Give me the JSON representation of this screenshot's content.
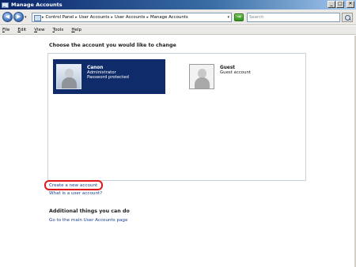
{
  "window": {
    "title": "Manage Accounts",
    "controls": {
      "minimize": "_",
      "maximize": "□",
      "close": "✕"
    }
  },
  "nav": {
    "back_icon": "◀",
    "forward_icon": "▶",
    "dropdown_icon": "▾",
    "address": {
      "breadcrumbs": [
        "Control Panel",
        "User Accounts",
        "User Accounts",
        "Manage Accounts"
      ],
      "separator": "▸"
    },
    "go_label": "→",
    "search_placeholder": "Search"
  },
  "menu": {
    "items": [
      "File",
      "Edit",
      "View",
      "Tools",
      "Help"
    ]
  },
  "main": {
    "heading": "Choose the account you would like to change",
    "accounts": [
      {
        "name": "Canon",
        "lines": [
          "Administrator",
          "Password protected"
        ],
        "selected": true
      },
      {
        "name": "Guest",
        "lines": [
          "Guest account"
        ],
        "selected": false
      }
    ],
    "links": {
      "create": "Create a new account",
      "whatis": "What is a user account?"
    },
    "additional_heading": "Additional things you can do",
    "main_page_link": "Go to the main User Accounts page"
  },
  "colors": {
    "selected_account_bg": "#0f2b6a",
    "link": "#1a3e8f",
    "highlight": "#e0171b"
  }
}
